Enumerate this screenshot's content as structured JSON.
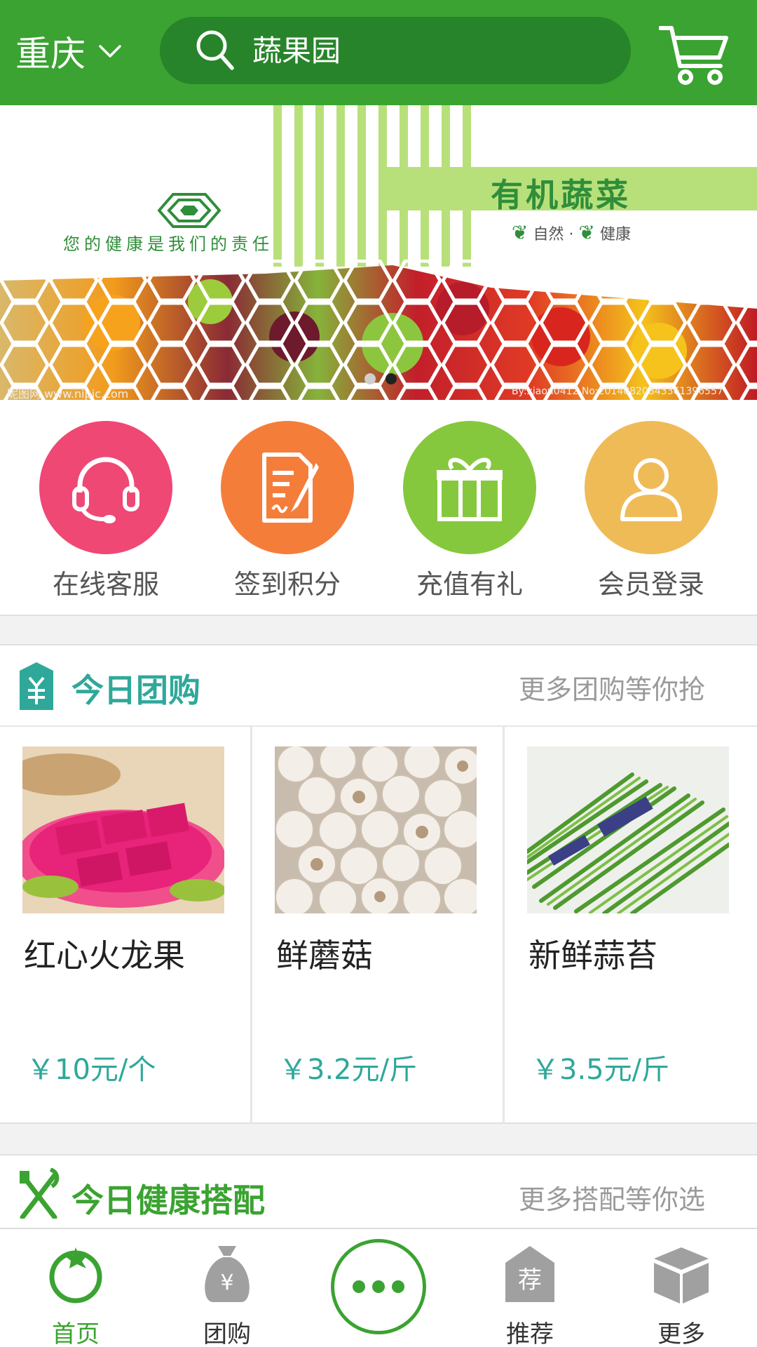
{
  "header": {
    "city": "重庆",
    "search_placeholder": "蔬果园"
  },
  "banner": {
    "title": "有机蔬菜",
    "subtitle_1": "自然",
    "subtitle_sep": "·",
    "subtitle_2": "健康",
    "slogan": "您的健康是我们的责任",
    "watermark": "昵图网 www.nipic.com",
    "watermark_id": "By:xiaou0412 No:20140820843361396557",
    "slide_count": 2,
    "active_slide": 2
  },
  "quick_menu": [
    {
      "label": "在线客服",
      "icon": "headset-icon",
      "color": "#ef4874"
    },
    {
      "label": "签到积分",
      "icon": "sign-document-icon",
      "color": "#f57d3a"
    },
    {
      "label": "充值有礼",
      "icon": "gift-icon",
      "color": "#86c83d"
    },
    {
      "label": "会员登录",
      "icon": "user-icon",
      "color": "#efbb57"
    }
  ],
  "group_buy": {
    "title": "今日团购",
    "more": "更多团购等你抢",
    "title_color": "#2fa89a",
    "products": [
      {
        "name": "红心火龙果",
        "price": "￥10元/个"
      },
      {
        "name": "鲜蘑菇",
        "price": "￥3.2元/斤"
      },
      {
        "name": "新鲜蒜苔",
        "price": "￥3.5元/斤"
      }
    ]
  },
  "health": {
    "title": "今日健康搭配",
    "more": "更多搭配等你选",
    "title_color": "#3aa331"
  },
  "tabbar": {
    "items": [
      {
        "label": "首页",
        "icon": "tomato-icon",
        "active": true
      },
      {
        "label": "团购",
        "icon": "money-bag-icon",
        "active": false
      },
      {
        "label": "",
        "icon": "more-dots-icon",
        "active": false
      },
      {
        "label": "推荐",
        "icon": "recommend-icon",
        "active": false
      },
      {
        "label": "更多",
        "icon": "box-icon",
        "active": false
      }
    ]
  },
  "colors": {
    "brand_green": "#3aa331",
    "search_bg": "#27842a",
    "price_teal": "#2fa89a"
  }
}
